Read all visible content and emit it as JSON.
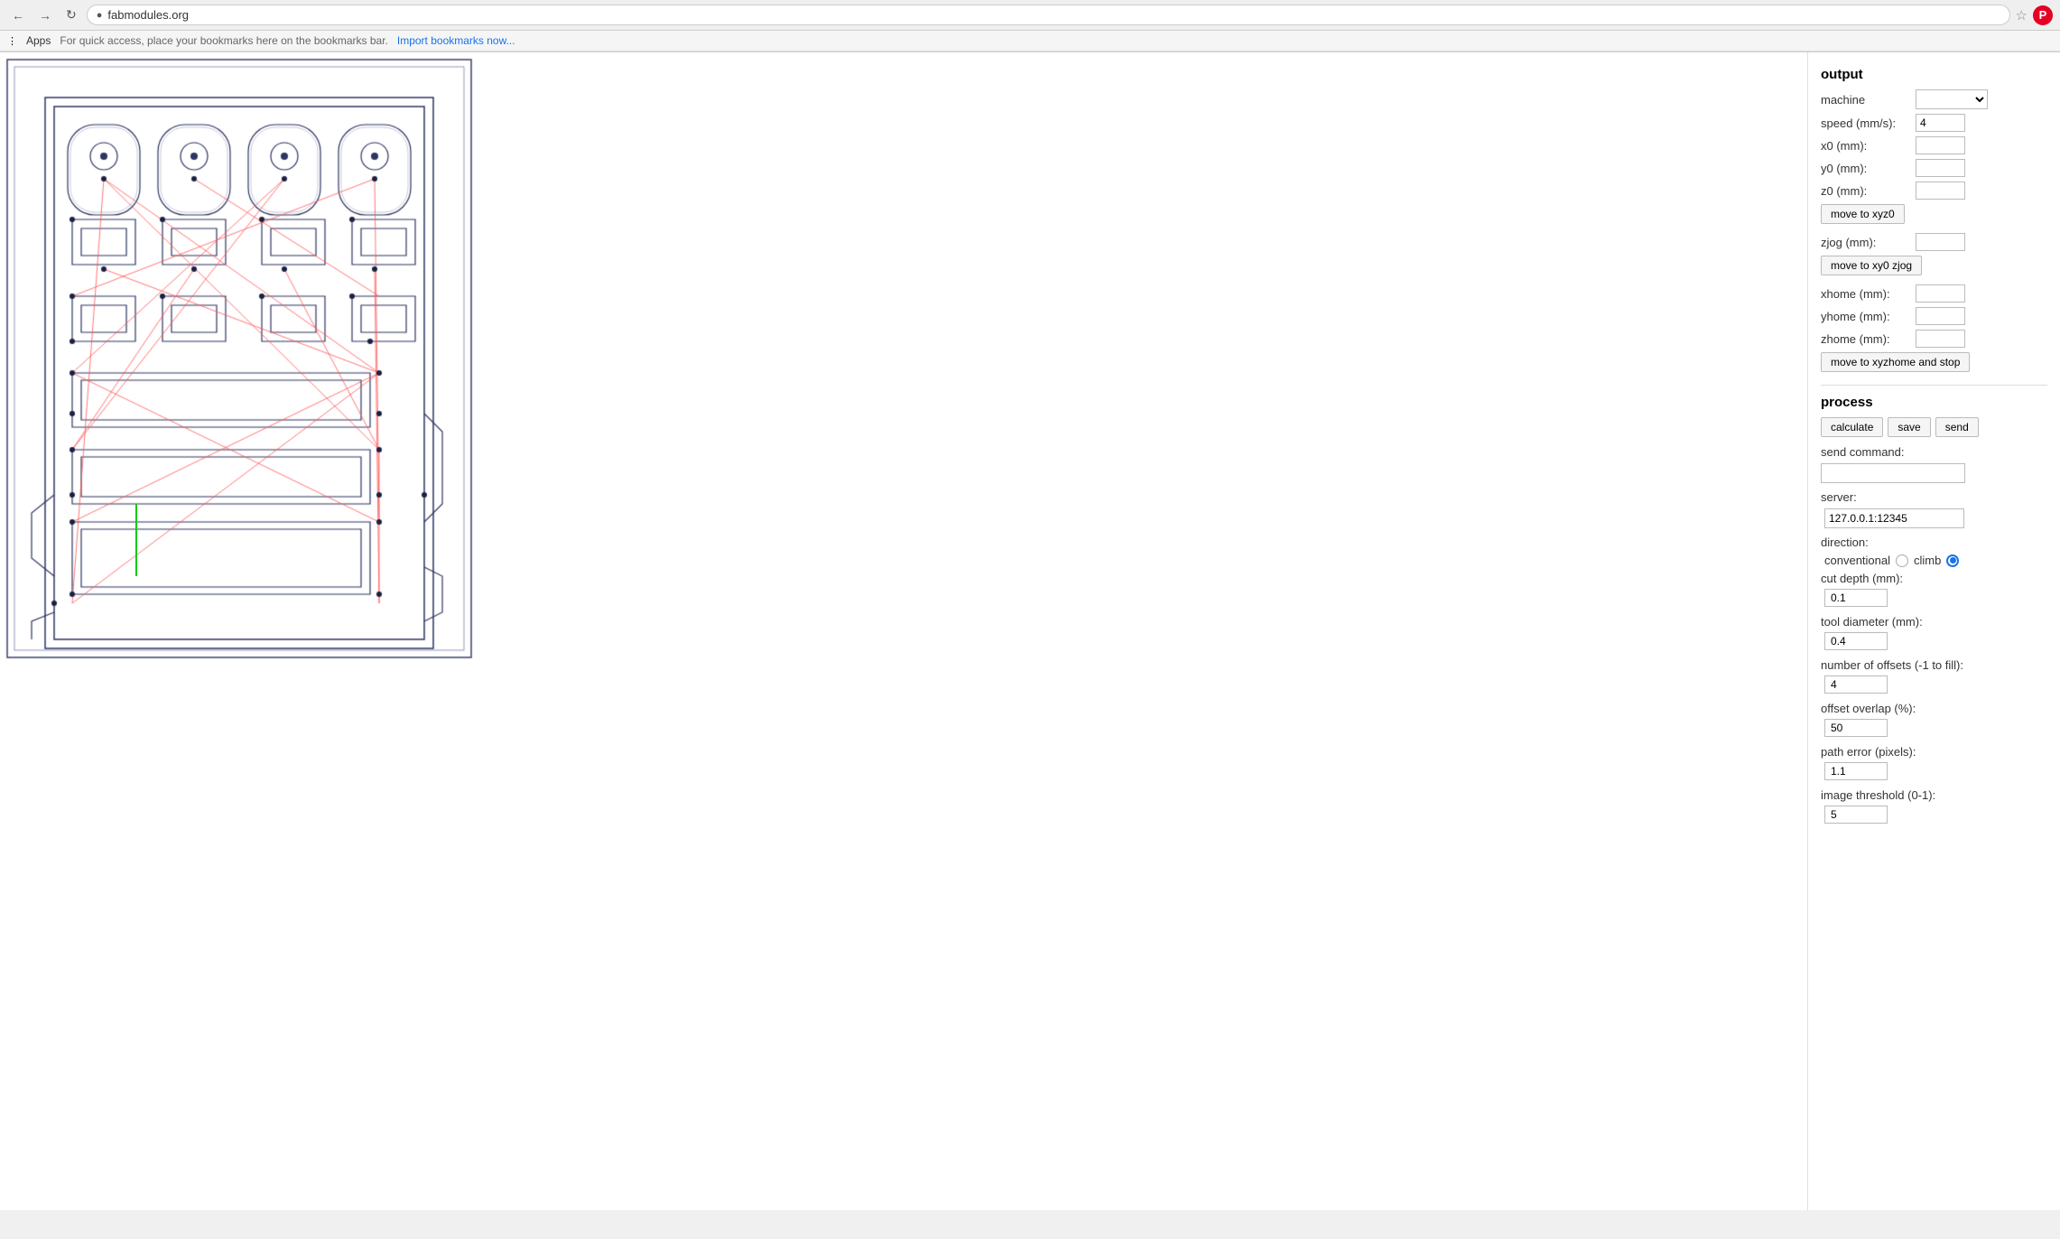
{
  "browser": {
    "url": "fabmodules.org",
    "back_disabled": false,
    "forward_disabled": false,
    "apps_label": "Apps",
    "bookmark_hint": "For quick access, place your bookmarks here on the bookmarks bar.",
    "import_label": "Import bookmarks now..."
  },
  "output": {
    "section_title": "output",
    "machine_label": "machine",
    "speed_label": "speed (mm/s):",
    "speed_value": "4",
    "x0_label": "x0 (mm):",
    "y0_label": "y0 (mm):",
    "z0_label": "z0 (mm):",
    "move_xyz0_label": "move to xyz0",
    "zjog_label": "zjog (mm):",
    "move_xy0zjog_label": "move to xy0 zjog",
    "xhome_label": "xhome (mm):",
    "yhome_label": "yhome (mm):",
    "zhome_label": "zhome (mm):",
    "move_xyzhome_label": "move to xyzhome and stop"
  },
  "process": {
    "section_title": "process",
    "calculate_label": "calculate",
    "save_label": "save",
    "send_label": "send",
    "send_command_label": "send command:",
    "server_label": "server:",
    "server_value": "127.0.0.1:12345",
    "direction_label": "direction:",
    "conventional_label": "conventional",
    "climb_label": "climb",
    "cut_depth_label": "cut depth (mm):",
    "cut_depth_value": "0.1",
    "tool_diameter_label": "tool diameter (mm):",
    "tool_diameter_value": "0.4",
    "num_offsets_label": "number of offsets (-1 to fill):",
    "num_offsets_value": "4",
    "offset_overlap_label": "offset overlap (%):",
    "offset_overlap_value": "50",
    "path_error_label": "path error (pixels):",
    "path_error_value": "1.1",
    "image_threshold_label": "image threshold (0-1):",
    "image_threshold_value": "5"
  },
  "colors": {
    "accent": "#1a73e8",
    "panel_bg": "#ffffff",
    "canvas_bg": "#ffffff",
    "outline": "#2d3561",
    "red_lines": "#ff4444",
    "green_line": "#00cc00"
  }
}
